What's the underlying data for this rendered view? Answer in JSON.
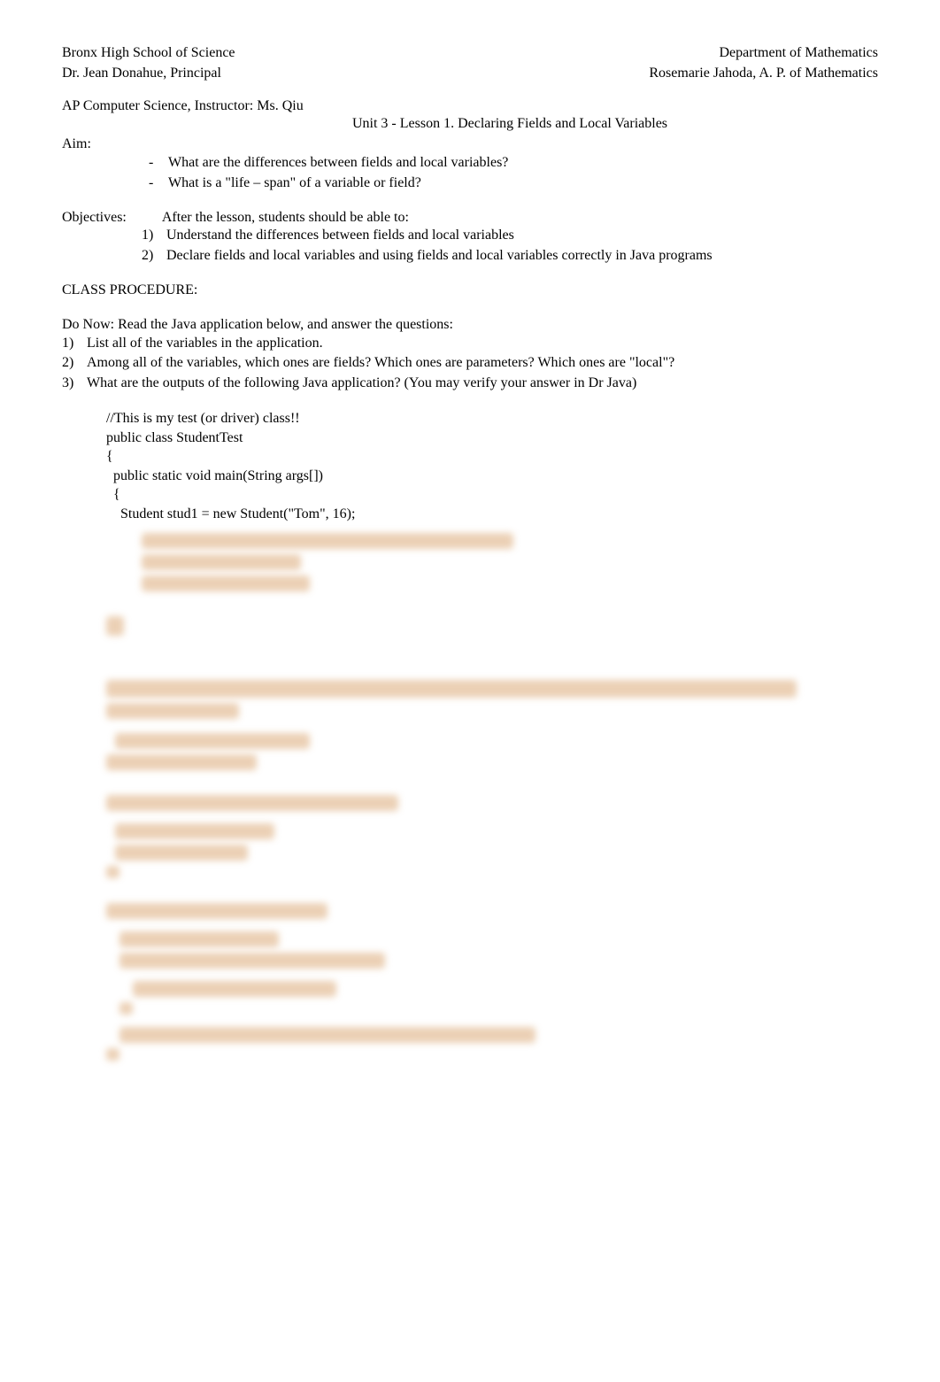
{
  "header": {
    "school": "Bronx High School of Science",
    "principal": "Dr. Jean Donahue, Principal",
    "department": "Department of Mathematics",
    "dept_head": "Rosemarie Jahoda, A. P. of Mathematics",
    "instructor": "AP Computer Science, Instructor: Ms. Qiu",
    "title": "Unit 3 - Lesson 1. Declaring Fields and Local Variables"
  },
  "aim": {
    "label": "Aim:",
    "items": [
      "What are the differences between fields and local variables?",
      "What is a \"life – span\" of a variable or field?"
    ]
  },
  "objectives": {
    "label": "Objectives:",
    "intro": "After the lesson, students should be able to:",
    "items": [
      "Understand the differences between fields and local variables",
      "Declare fields and local variables and using fields and local variables correctly in Java programs"
    ]
  },
  "procedure": {
    "label": "CLASS PROCEDURE:"
  },
  "donow": {
    "intro": "Do Now: Read the Java application below, and answer the questions:",
    "items": [
      "List all of the variables in the application.",
      "Among all of the variables, which ones are fields? Which ones are parameters? Which ones are \"local\"?",
      "What are the outputs of the following Java application? (You may verify your answer in Dr Java)"
    ]
  },
  "code": {
    "line1": "//This is my test (or driver) class!!",
    "line2": "public class StudentTest",
    "line3": "{",
    "line4": "  public static void main(String args[])",
    "line5": "  {",
    "line6": "    Student stud1 = new Student(\"Tom\", 16);"
  }
}
